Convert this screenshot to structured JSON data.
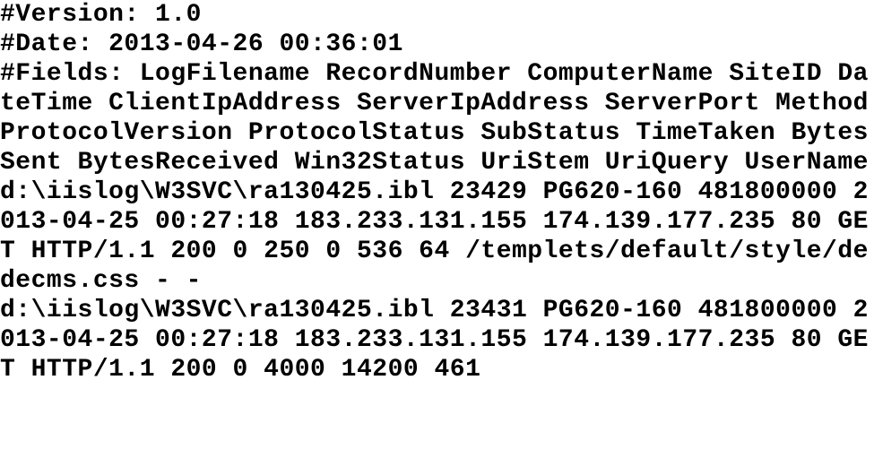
{
  "log": {
    "header": {
      "version_line": "#Version: 1.0",
      "date_line": "#Date: 2013-04-26 00:36:01",
      "fields_label": "#Fields:",
      "fields": [
        "LogFilename",
        "RecordNumber",
        "ComputerName",
        "SiteID",
        "DateTime",
        "ClientIpAddress",
        "ServerIpAddress",
        "ServerPort",
        "Method",
        "ProtocolVersion",
        "ProtocolStatus",
        "SubStatus",
        "TimeTaken",
        "BytesSent",
        "BytesReceived",
        "Win32Status",
        "UriStem",
        "UriQuery",
        "UserName"
      ]
    },
    "entries": [
      {
        "LogFilename": "d:\\iislog\\W3SVC\\ra130425.ibl",
        "RecordNumber": "23429",
        "ComputerName": "PG620-160",
        "SiteID": "481800000",
        "DateTime": "2013-04-25 00:27:18",
        "ClientIpAddress": "183.233.131.155",
        "ServerIpAddress": "174.139.177.235",
        "ServerPort": "80",
        "Method": "GET",
        "ProtocolVersion": "HTTP/1.1",
        "ProtocolStatus": "200",
        "SubStatus": "0",
        "TimeTaken": "250",
        "BytesSent": "0",
        "BytesReceived": "536",
        "Win32Status": "64",
        "UriStem": "/templets/default/style/dedecms.css",
        "UriQuery": "-",
        "UserName": "-"
      },
      {
        "LogFilename": "d:\\iislog\\W3SVC\\ra130425.ibl",
        "RecordNumber": "23431",
        "ComputerName": "PG620-160",
        "SiteID": "481800000",
        "DateTime": "2013-04-25 00:27:18",
        "ClientIpAddress": "183.233.131.155",
        "ServerIpAddress": "174.139.177.235",
        "ServerPort": "80",
        "Method": "GET",
        "ProtocolVersion": "HTTP/1.1",
        "ProtocolStatus": "200",
        "SubStatus": "0",
        "TimeTaken": "4000",
        "BytesSent": "14200",
        "BytesReceived": "461"
      }
    ],
    "rendered_lines": [
      "#Version: 1.0",
      "#Date: 2013-04-26 00:36:01",
      "#Fields: LogFilename RecordNumber ComputerName SiteID DateTime ClientIpAddress ServerIpAddress ServerPort Method ProtocolVersion ProtocolStatus SubStatus TimeTaken BytesSent BytesReceived Win32Status UriStem UriQuery UserName",
      "d:\\iislog\\W3SVC\\ra130425.ibl 23429 PG620-160 481800000 2013-04-25 00:27:18 183.233.131.155 174.139.177.235 80 GET HTTP/1.1 200 0 250 0 536 64 /templets/default/style/dedecms.css - -",
      "d:\\iislog\\W3SVC\\ra130425.ibl 23431 PG620-160 481800000 2013-04-25 00:27:18 183.233.131.155 174.139.177.235 80 GET HTTP/1.1 200 0 4000 14200 461"
    ]
  }
}
